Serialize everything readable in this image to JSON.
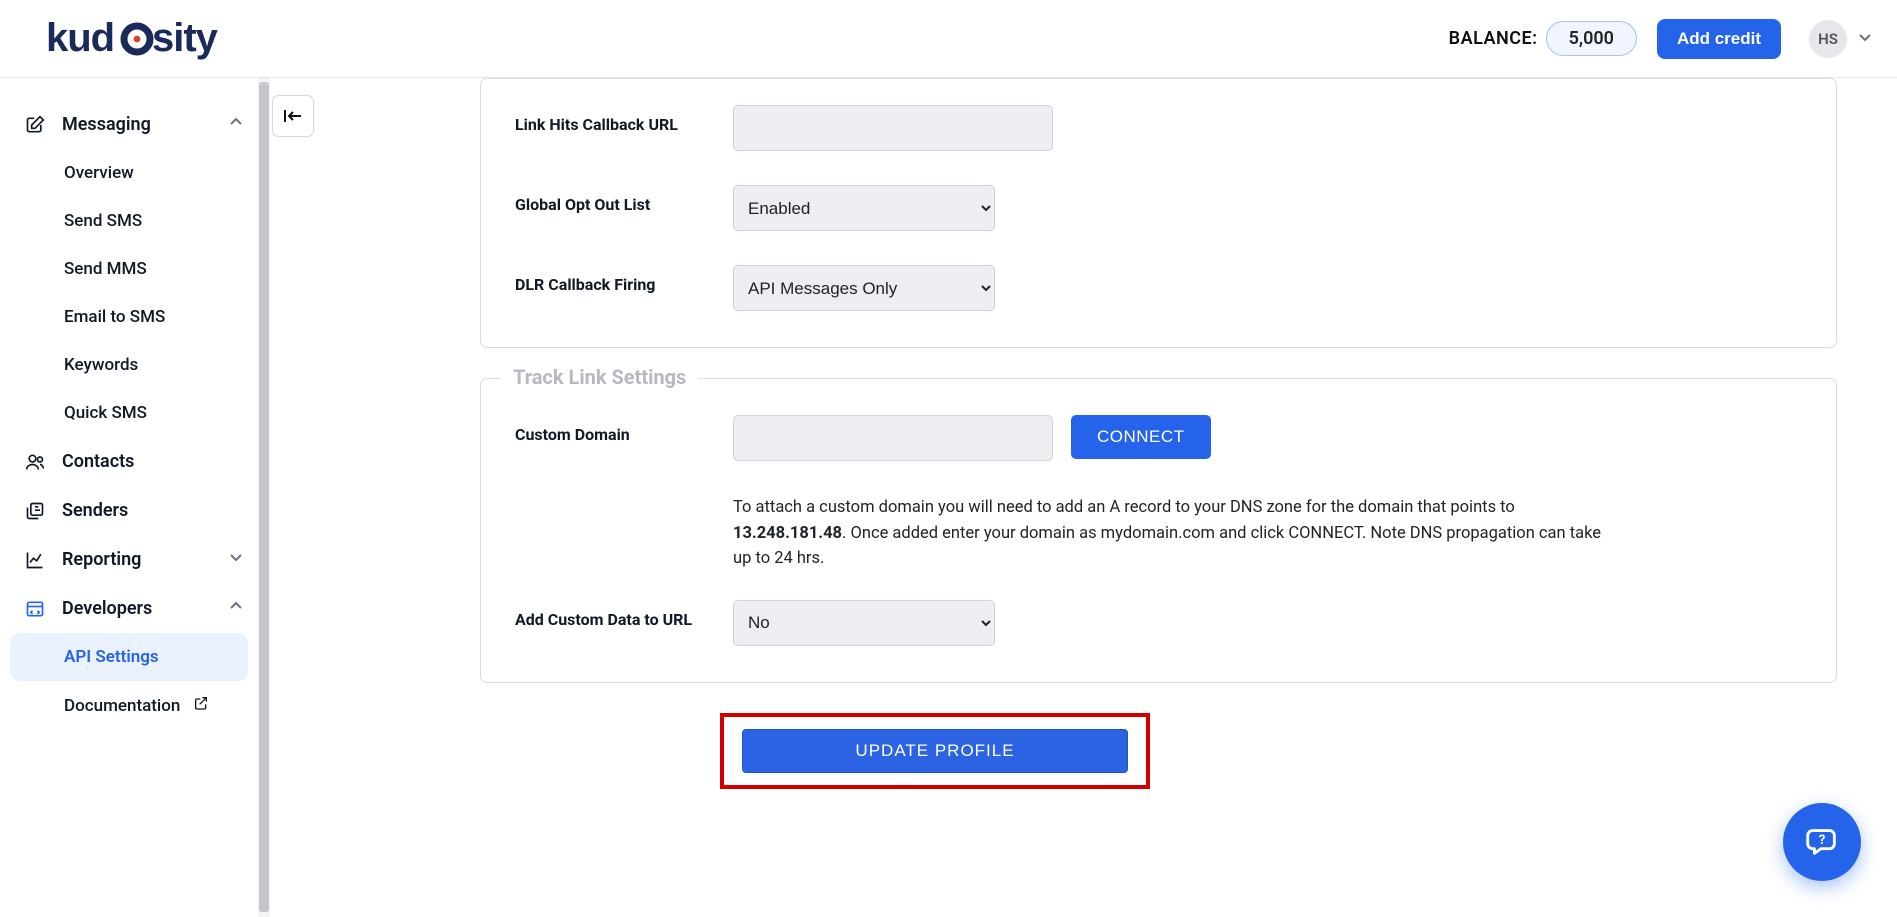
{
  "header": {
    "balance_label": "BALANCE:",
    "balance_value": "5,000",
    "add_credit_label": "Add credit",
    "avatar_initials": "HS"
  },
  "sidebar": {
    "sections": {
      "messaging": {
        "label": "Messaging",
        "expanded": true
      },
      "contacts": {
        "label": "Contacts"
      },
      "senders": {
        "label": "Senders"
      },
      "reporting": {
        "label": "Reporting",
        "expanded": false
      },
      "developers": {
        "label": "Developers",
        "expanded": true
      }
    },
    "messaging_items": [
      {
        "label": "Overview"
      },
      {
        "label": "Send SMS"
      },
      {
        "label": "Send MMS"
      },
      {
        "label": "Email to SMS"
      },
      {
        "label": "Keywords"
      },
      {
        "label": "Quick SMS"
      }
    ],
    "developer_items": [
      {
        "label": "API Settings",
        "active": true
      },
      {
        "label": "Documentation",
        "external": true
      }
    ]
  },
  "form": {
    "top_panel": {
      "link_hits_label": "Link Hits Callback URL",
      "link_hits_value": "",
      "global_optout_label": "Global Opt Out List",
      "global_optout_value": "Enabled",
      "dlr_label": "DLR Callback Firing",
      "dlr_value": "API Messages Only"
    },
    "track_panel": {
      "legend": "Track Link Settings",
      "custom_domain_label": "Custom Domain",
      "custom_domain_value": "",
      "connect_label": "CONNECT",
      "help_pre": "To attach a custom domain you will need to add an A record to your DNS zone for the domain that points to ",
      "help_ip": "13.248.181.48",
      "help_post": ". Once added enter your domain as mydomain.com and click CONNECT. Note DNS propagation can take up to 24 hrs.",
      "add_custom_data_label": "Add Custom Data to URL",
      "add_custom_data_value": "No"
    },
    "update_label": "UPDATE PROFILE"
  }
}
